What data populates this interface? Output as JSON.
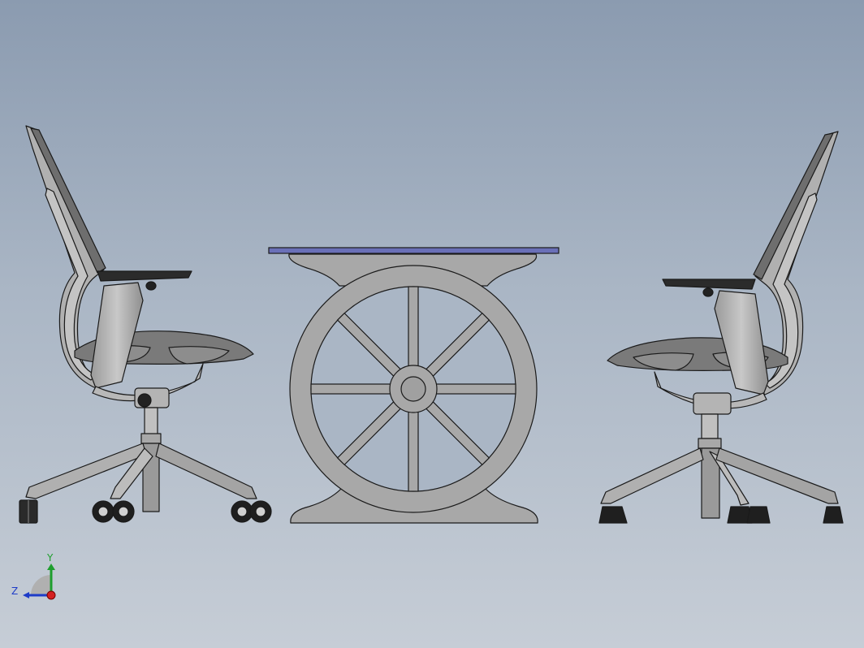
{
  "viewport": {
    "background_top": "#8b9bb0",
    "background_bottom": "#c6cdd6"
  },
  "model": {
    "parts": [
      "left-office-chair",
      "wagon-wheel-table",
      "right-office-chair"
    ],
    "colors": {
      "metal": "#a8a8a8",
      "metal_dark": "#8c8c8c",
      "seat": "#7a7a7a",
      "armrest": "#2b2b2b",
      "tabletop": "#6a70b8",
      "outline": "#1a1a1a"
    }
  },
  "triad": {
    "y_label": "Y",
    "z_label": "Z",
    "y_color": "#1e9e2e",
    "z_color": "#1e3cc8",
    "x_color": "#d42020"
  }
}
